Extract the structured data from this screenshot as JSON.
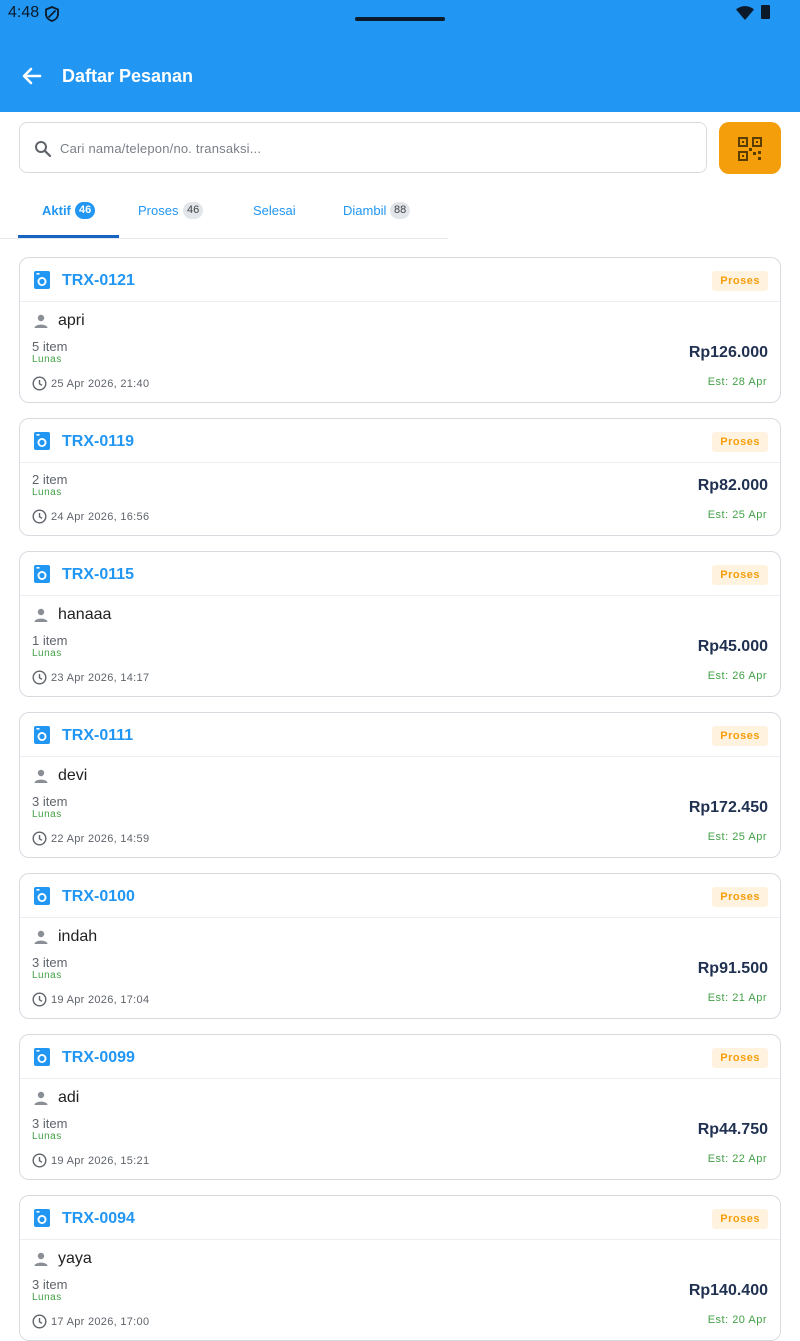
{
  "status_bar": {
    "time": "4:48"
  },
  "header": {
    "title": "Daftar Pesanan"
  },
  "search": {
    "placeholder": "Cari nama/telepon/no. transaksi..."
  },
  "tabs": [
    {
      "label": "Aktif",
      "count": "46",
      "active": true
    },
    {
      "label": "Proses",
      "count": "46"
    },
    {
      "label": "Selesai",
      "count": ""
    },
    {
      "label": "Diambil",
      "count": "88"
    }
  ],
  "orders": [
    {
      "id": "TRX-0121",
      "status": "Proses",
      "customer": "apri",
      "items": "5 item",
      "payment": "Lunas",
      "date": "25 Apr 2026, 21:40",
      "total": "Rp126.000",
      "est": "Est: 28 Apr"
    },
    {
      "id": "TRX-0119",
      "status": "Proses",
      "customer": "",
      "items": "2 item",
      "payment": "Lunas",
      "date": "24 Apr 2026, 16:56",
      "total": "Rp82.000",
      "est": "Est: 25 Apr"
    },
    {
      "id": "TRX-0115",
      "status": "Proses",
      "customer": "hanaaa",
      "items": "1 item",
      "payment": "Lunas",
      "date": "23 Apr 2026, 14:17",
      "total": "Rp45.000",
      "est": "Est: 26 Apr"
    },
    {
      "id": "TRX-0111",
      "status": "Proses",
      "customer": "devi",
      "items": "3 item",
      "payment": "Lunas",
      "date": "22 Apr 2026, 14:59",
      "total": "Rp172.450",
      "est": "Est: 25 Apr"
    },
    {
      "id": "TRX-0100",
      "status": "Proses",
      "customer": "indah",
      "items": "3 item",
      "payment": "Lunas",
      "date": "19 Apr 2026, 17:04",
      "total": "Rp91.500",
      "est": "Est: 21 Apr"
    },
    {
      "id": "TRX-0099",
      "status": "Proses",
      "customer": "adi",
      "items": "3 item",
      "payment": "Lunas",
      "date": "19 Apr 2026, 15:21",
      "total": "Rp44.750",
      "est": "Est: 22 Apr"
    },
    {
      "id": "TRX-0094",
      "status": "Proses",
      "customer": "yaya",
      "items": "3 item",
      "payment": "Lunas",
      "date": "17 Apr 2026, 17:00",
      "total": "Rp140.400",
      "est": "Est: 20 Apr"
    }
  ],
  "colors": {
    "primary": "#2196f3",
    "accent": "#f59e0b",
    "success": "#43a047",
    "price": "#1f3050"
  }
}
